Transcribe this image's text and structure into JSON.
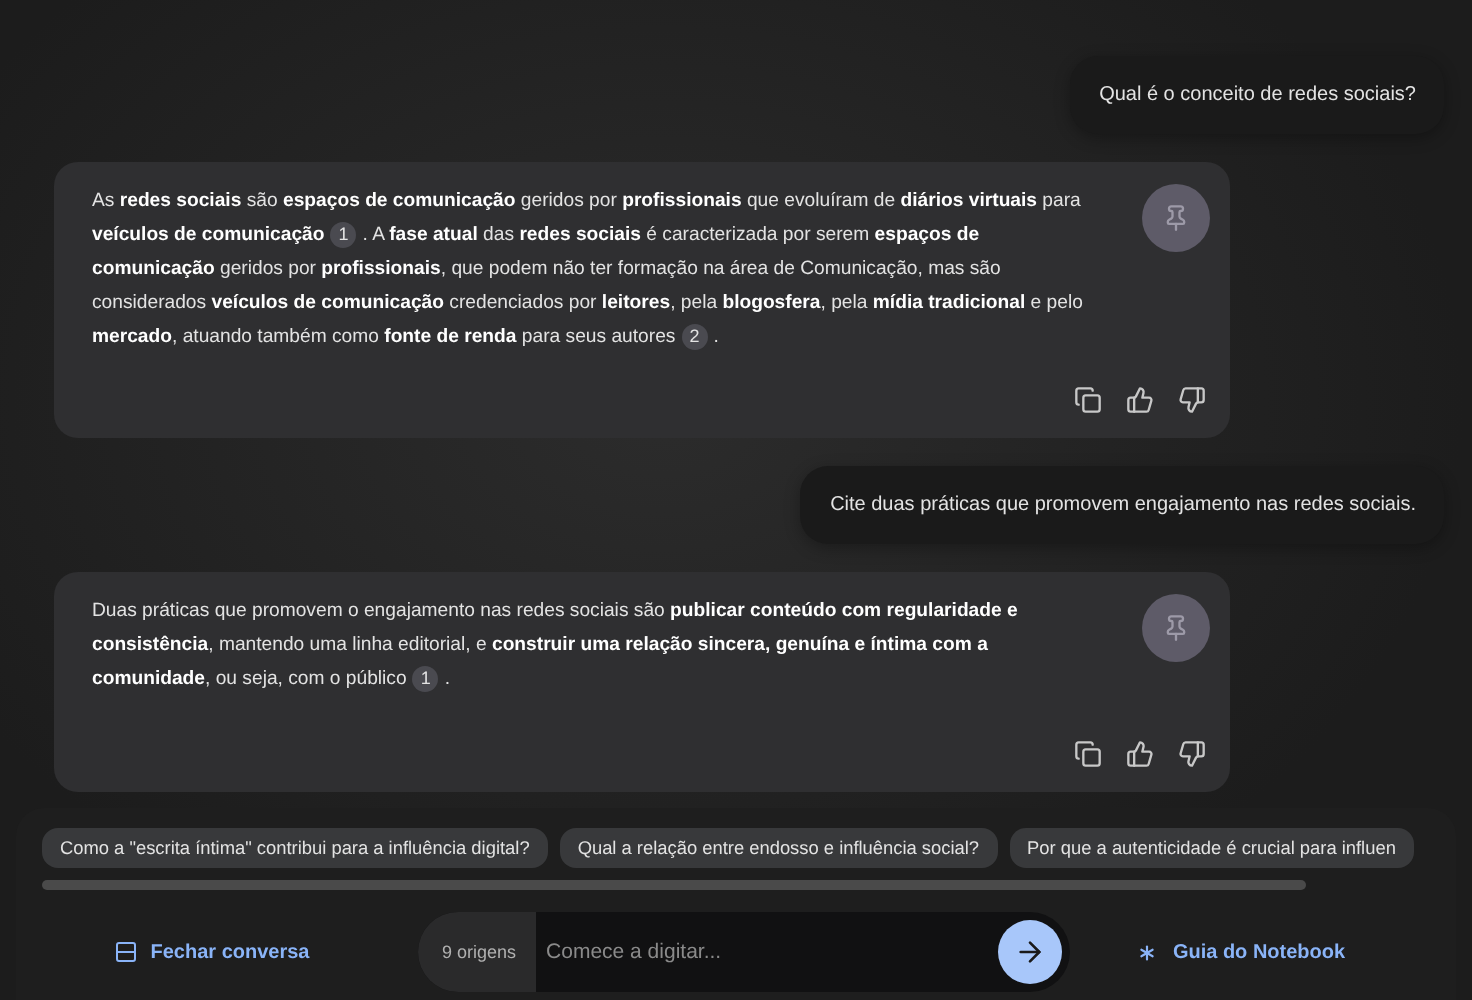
{
  "messages": [
    {
      "kind": "user",
      "text": "Qual é o conceito de redes sociais?"
    },
    {
      "kind": "answer",
      "segments": [
        {
          "kind": "text",
          "text": "As **redes sociais** são **espaços de comunicação** geridos por **profissionais** que evoluíram de **diários virtuais** para **veículos de comunicação**"
        },
        {
          "kind": "citation",
          "text": "1"
        },
        {
          "kind": "text",
          "text": ". A **fase atual** das **redes sociais** é caracterizada por serem **espaços de comunicação** geridos por **profissionais**, que podem não ter formação na área de Comunicação, mas são considerados **veículos de comunicação** credenciados por **leitores**, pela **blogosfera**, pela **mídia tradicional** e pelo **mercado**, atuando também como **fonte de renda** para seus autores"
        },
        {
          "kind": "citation",
          "text": "2"
        },
        {
          "kind": "text",
          "text": "."
        }
      ]
    },
    {
      "kind": "user",
      "text": "Cite duas práticas que promovem engajamento nas redes sociais."
    },
    {
      "kind": "answer",
      "segments": [
        {
          "kind": "text",
          "text": "Duas práticas que promovem o engajamento nas redes sociais são **publicar conteúdo com regularidade e consistência**, mantendo uma linha editorial, e **construir uma relação sincera, genuína e íntima com a comunidade**, ou seja, com o público"
        },
        {
          "kind": "citation",
          "text": "1"
        },
        {
          "kind": "text",
          "text": "."
        }
      ]
    }
  ],
  "suggestions": [
    "Como a \"escrita íntima\" contribui para a influência digital?",
    "Qual a relação entre endosso e influência social?",
    "Por que a autenticidade é crucial para influen"
  ],
  "footer": {
    "close_label": "Fechar conversa",
    "sources": "9 origens",
    "input": {
      "placeholder": "Comece a digitar..."
    },
    "guide_label": "Guia do Notebook"
  }
}
